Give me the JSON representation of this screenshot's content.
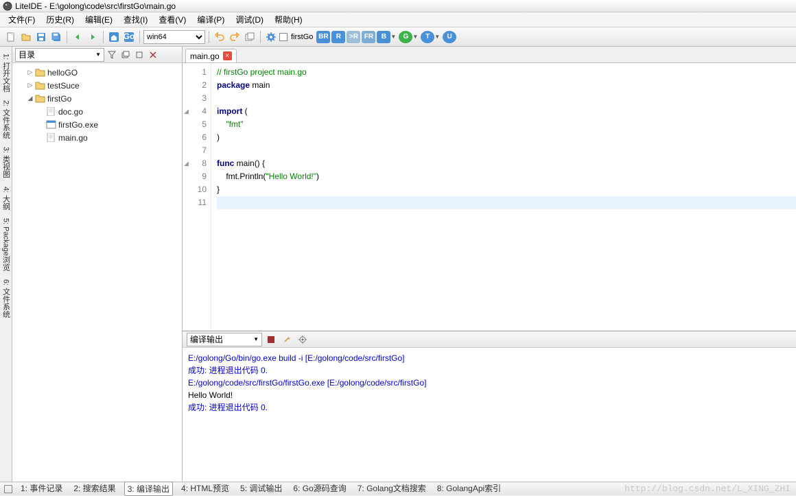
{
  "titlebar": {
    "text": "LiteIDE - E:\\golong\\code\\src\\firstGo\\main.go"
  },
  "menubar": {
    "items": [
      "文件(F)",
      "历史(R)",
      "编辑(E)",
      "查找(I)",
      "查看(V)",
      "编译(P)",
      "调试(D)",
      "帮助(H)"
    ]
  },
  "toolbar": {
    "env_combo": "win64",
    "app_name": "firstGo",
    "badges": [
      "BR",
      "R",
      ">R",
      "FR",
      "B",
      "G",
      "T",
      "U"
    ]
  },
  "sidebar": {
    "dropdown": "目录",
    "tree": [
      {
        "label": "helloGO",
        "type": "folder",
        "indent": 1,
        "expanded": false
      },
      {
        "label": "testSuce",
        "type": "folder",
        "indent": 1,
        "expanded": false
      },
      {
        "label": "firstGo",
        "type": "folder",
        "indent": 1,
        "expanded": true
      },
      {
        "label": "doc.go",
        "type": "file",
        "indent": 2
      },
      {
        "label": "firstGo.exe",
        "type": "exe",
        "indent": 2
      },
      {
        "label": "main.go",
        "type": "file",
        "indent": 2
      }
    ]
  },
  "lefttabs": [
    "1: 打开文档",
    "2: 文件系统",
    "3: 类视图",
    "4: 大纲",
    "5: Package浏览",
    "6: 文件系统"
  ],
  "editor": {
    "tab": "main.go",
    "lines": [
      {
        "n": 1,
        "tokens": [
          {
            "t": "// firstGo project main.go",
            "c": "cm"
          }
        ]
      },
      {
        "n": 2,
        "tokens": [
          {
            "t": "package",
            "c": "kw"
          },
          {
            "t": " main",
            "c": "id"
          }
        ]
      },
      {
        "n": 3,
        "tokens": []
      },
      {
        "n": 4,
        "fold": true,
        "tokens": [
          {
            "t": "import",
            "c": "kw"
          },
          {
            "t": " (",
            "c": "id"
          }
        ]
      },
      {
        "n": 5,
        "tokens": [
          {
            "t": "    \"fmt\"",
            "c": "st"
          }
        ]
      },
      {
        "n": 6,
        "tokens": [
          {
            "t": ")",
            "c": "id"
          }
        ]
      },
      {
        "n": 7,
        "tokens": []
      },
      {
        "n": 8,
        "fold": true,
        "tokens": [
          {
            "t": "func",
            "c": "kw"
          },
          {
            "t": " main() {",
            "c": "id"
          }
        ]
      },
      {
        "n": 9,
        "tokens": [
          {
            "t": "    fmt.Println(",
            "c": "id"
          },
          {
            "t": "\"Hello World!\"",
            "c": "st"
          },
          {
            "t": ")",
            "c": "id"
          }
        ]
      },
      {
        "n": 10,
        "tokens": [
          {
            "t": "}",
            "c": "id"
          }
        ]
      },
      {
        "n": 11,
        "hl": true,
        "tokens": []
      }
    ]
  },
  "output": {
    "dropdown": "编译输出",
    "lines": [
      {
        "text": "E:/golong/Go/bin/go.exe build -i [E:/golong/code/src/firstGo]",
        "cls": "out-blue"
      },
      {
        "text": "成功: 进程退出代码 0.",
        "cls": "out-blue"
      },
      {
        "text": "E:/golong/code/src/firstGo/firstGo.exe  [E:/golong/code/src/firstGo]",
        "cls": "out-blue"
      },
      {
        "text": "Hello World!",
        "cls": "out-black"
      },
      {
        "text": "成功: 进程退出代码 0.",
        "cls": "out-blue"
      }
    ]
  },
  "bottombar": {
    "tabs": [
      "1: 事件记录",
      "2: 搜索结果",
      "3: 编译输出",
      "4: HTML预览",
      "5: 调试输出",
      "6: Go源码查询",
      "7: Golang文档搜索",
      "8: GolangApi索引"
    ],
    "active": 2,
    "watermark": "http://blog.csdn.net/L_XING_ZHI"
  }
}
